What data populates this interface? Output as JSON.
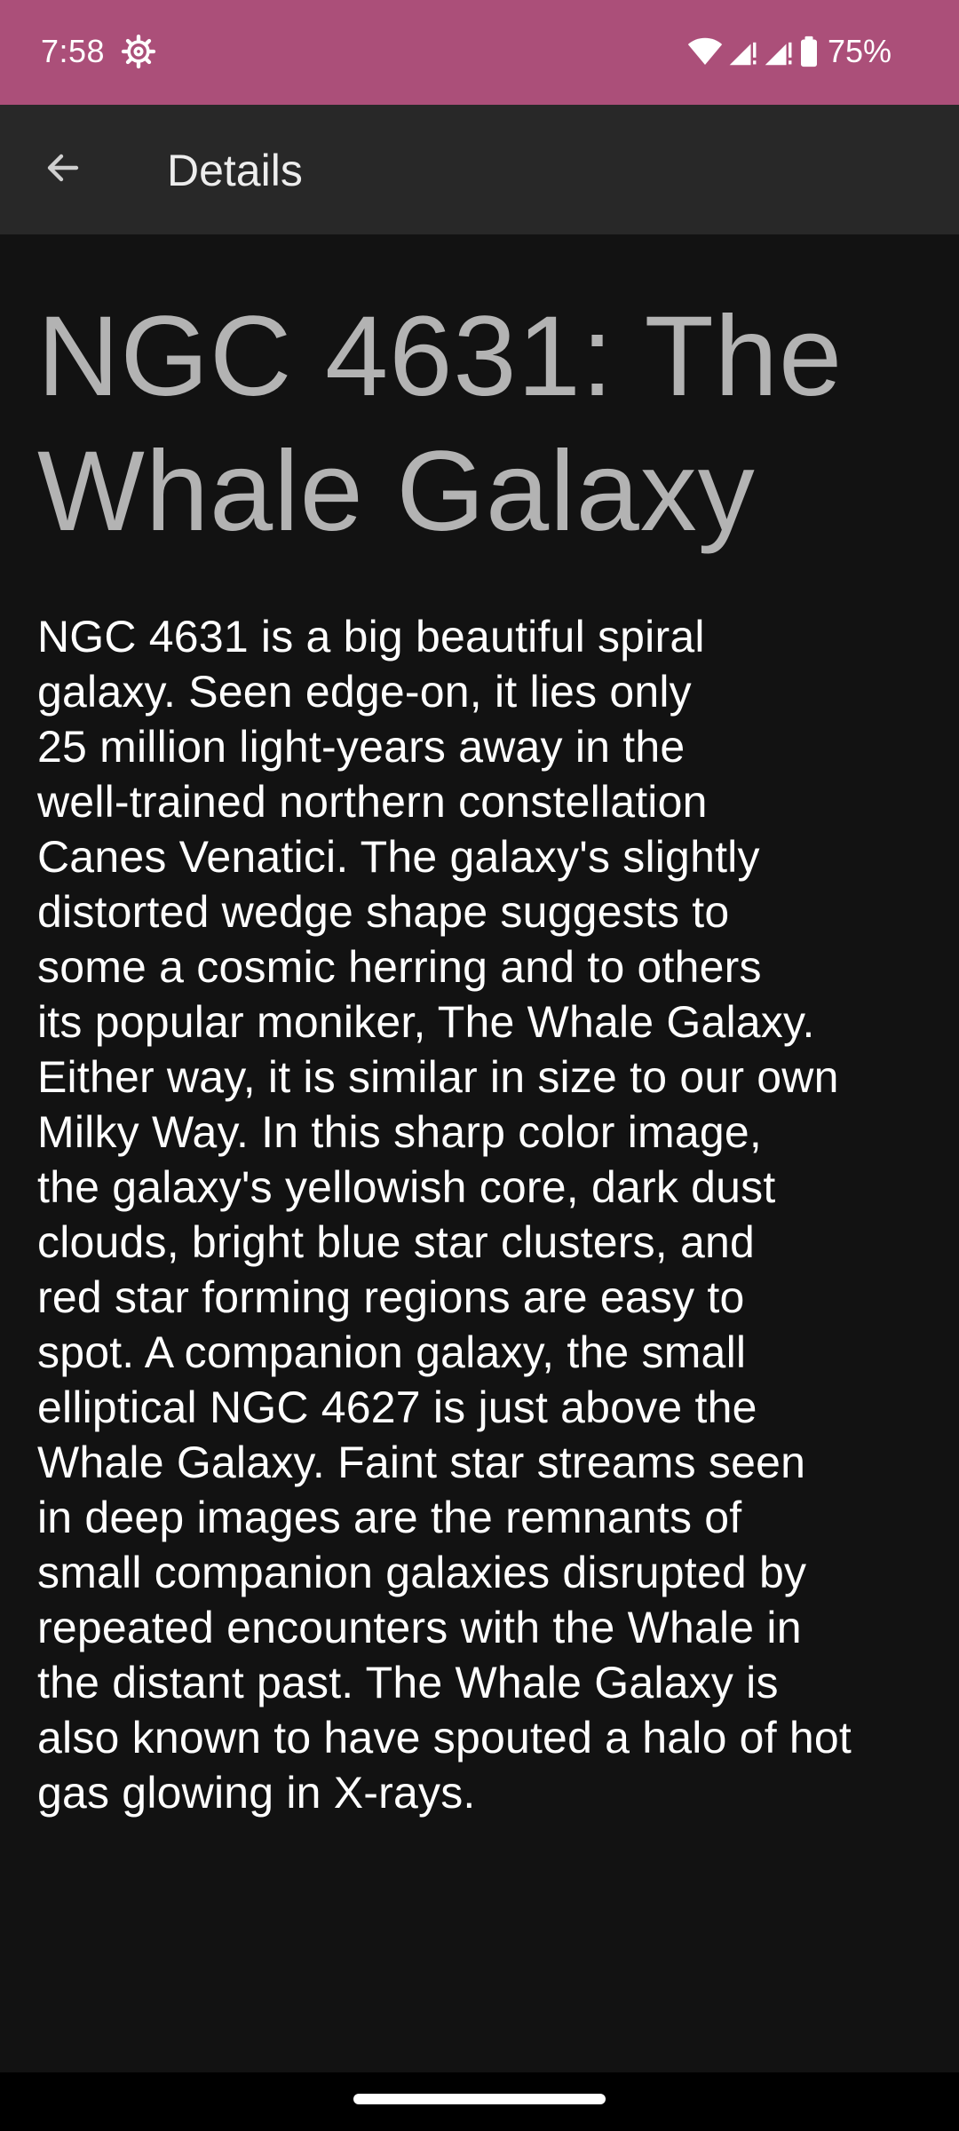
{
  "status_bar": {
    "time": "7:58",
    "battery": "75%",
    "icons": [
      "settings-icon",
      "wifi-icon",
      "signal-icon",
      "signal-icon",
      "battery-icon"
    ],
    "background": "#ab4f79"
  },
  "app_bar": {
    "back_icon": "arrow-back-icon",
    "title": "Details",
    "background": "#282828"
  },
  "article": {
    "title": "NGC 4631: The\nWhale Galaxy",
    "body": "NGC 4631 is a big beautiful spiral\ngalaxy. Seen edge-on, it lies only\n25 million light-years away in the\nwell-trained northern constellation\nCanes Venatici. The galaxy's slightly\ndistorted wedge shape suggests to\nsome a cosmic herring and to others\nits popular moniker, The Whale Galaxy.\nEither way, it is similar in size to our own\nMilky Way. In this sharp color image,\nthe galaxy's yellowish core, dark dust\nclouds, bright blue star clusters, and\nred star forming regions are easy to\nspot. A companion galaxy, the small\nelliptical NGC 4627 is just above the\nWhale Galaxy. Faint star streams seen\nin deep images are the remnants of\nsmall companion galaxies disrupted by\nrepeated encounters with the Whale in\nthe distant past. The Whale Galaxy is\nalso known to have spouted a halo of hot\ngas glowing in X-rays."
  },
  "colors": {
    "page_background": "#121212",
    "title_text": "#b3b3b3",
    "body_text": "#ffffff"
  }
}
